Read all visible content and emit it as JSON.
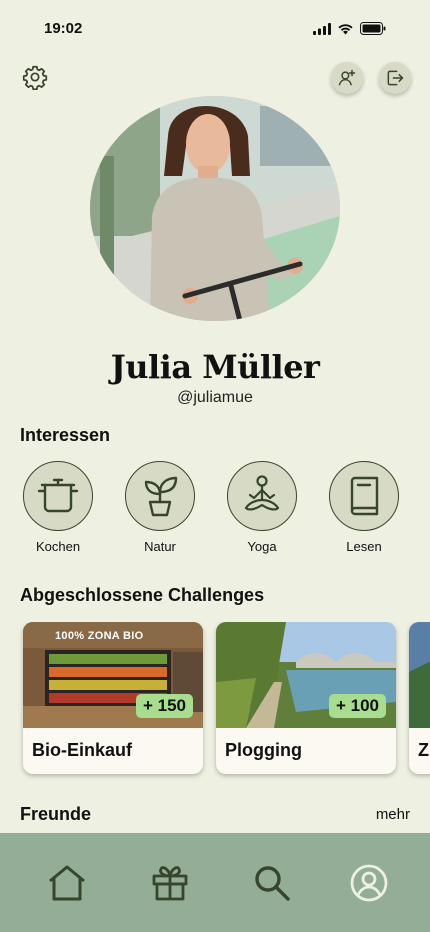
{
  "status": {
    "time": "19:02"
  },
  "profile": {
    "name": "Julia Müller",
    "handle": "@juliamue"
  },
  "interests": {
    "title": "Interessen",
    "items": [
      {
        "label": "Kochen",
        "icon": "pot-icon"
      },
      {
        "label": "Natur",
        "icon": "plant-icon"
      },
      {
        "label": "Yoga",
        "icon": "yoga-icon"
      },
      {
        "label": "Lesen",
        "icon": "book-icon"
      }
    ]
  },
  "challenges": {
    "title": "Abgeschlossene Challenges",
    "items": [
      {
        "label": "Bio-Einkauf",
        "points": "+ 150",
        "sign": "100% ZONA BIO"
      },
      {
        "label": "Plogging",
        "points": "+ 100"
      },
      {
        "label": "Z"
      }
    ]
  },
  "friends": {
    "title": "Freunde",
    "more": "mehr"
  },
  "nav": {
    "items": [
      "home-icon",
      "gift-icon",
      "search-icon",
      "profile-icon"
    ]
  },
  "colors": {
    "background": "#eef0e1",
    "nav": "#93ad97",
    "accent": "#37452d",
    "badge": "#a8dc8e"
  }
}
